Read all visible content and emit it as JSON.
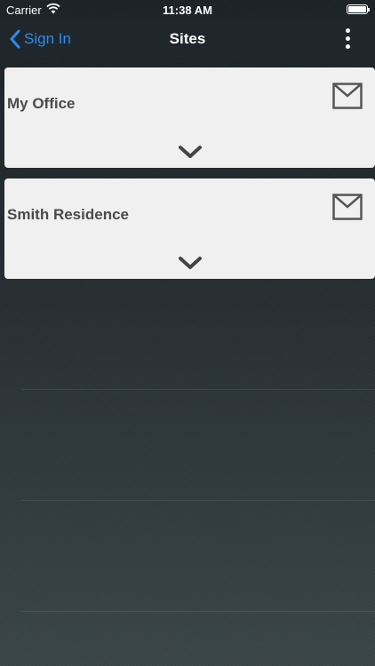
{
  "status_bar": {
    "carrier": "Carrier",
    "time": "11:38 AM"
  },
  "nav": {
    "back_label": "Sign In",
    "title": "Sites",
    "accent_color": "#2a8cf2"
  },
  "sites": [
    {
      "name": "My Office"
    },
    {
      "name": "Smith Residence"
    }
  ],
  "icons": {
    "back": "chevron-left-icon",
    "more": "vertical-ellipsis-icon",
    "mail": "envelope-icon",
    "expand": "chevron-down-icon"
  }
}
